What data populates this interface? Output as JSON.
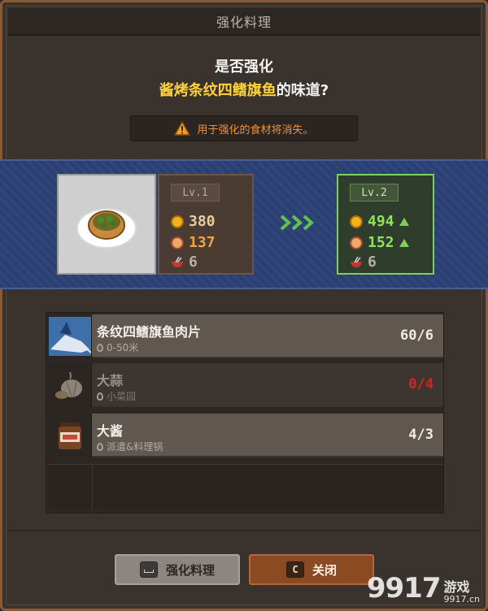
{
  "dialog": {
    "title": "强化料理",
    "question_prefix": "是否强化",
    "dish_name": "酱烤条纹四鳍旗鱼",
    "question_suffix": "的味道?",
    "warning": "用于强化的食材将消失。"
  },
  "current": {
    "level": "Lv.1",
    "price": "380",
    "appeal": "137",
    "portions": "6"
  },
  "next": {
    "level": "Lv.2",
    "price": "494",
    "appeal": "152",
    "portions": "6"
  },
  "ingredients": [
    {
      "name": "条纹四鳍旗鱼肉片",
      "location": "0-50米",
      "count": "60/6",
      "sufficient": true
    },
    {
      "name": "大蒜",
      "location": "小菜园",
      "count": "0/4",
      "sufficient": false
    },
    {
      "name": "大酱",
      "location": "派遣&料理锅",
      "count": "4/3",
      "sufficient": true
    }
  ],
  "buttons": {
    "upgrade_label": "强化料理",
    "upgrade_key": "space",
    "close_label": "关闭",
    "close_key": "C"
  },
  "watermark": {
    "number": "9917",
    "text": "游戏",
    "domain": "9917.cn"
  },
  "colors": {
    "highlight": "#ffd23a",
    "warning": "#f0903a",
    "increase": "#7fd05a",
    "lacking": "#e02020"
  },
  "icons": [
    "warning-icon",
    "coin-icon",
    "face-icon",
    "bowl-icon",
    "chevron-right-icon",
    "location-pin-icon"
  ]
}
